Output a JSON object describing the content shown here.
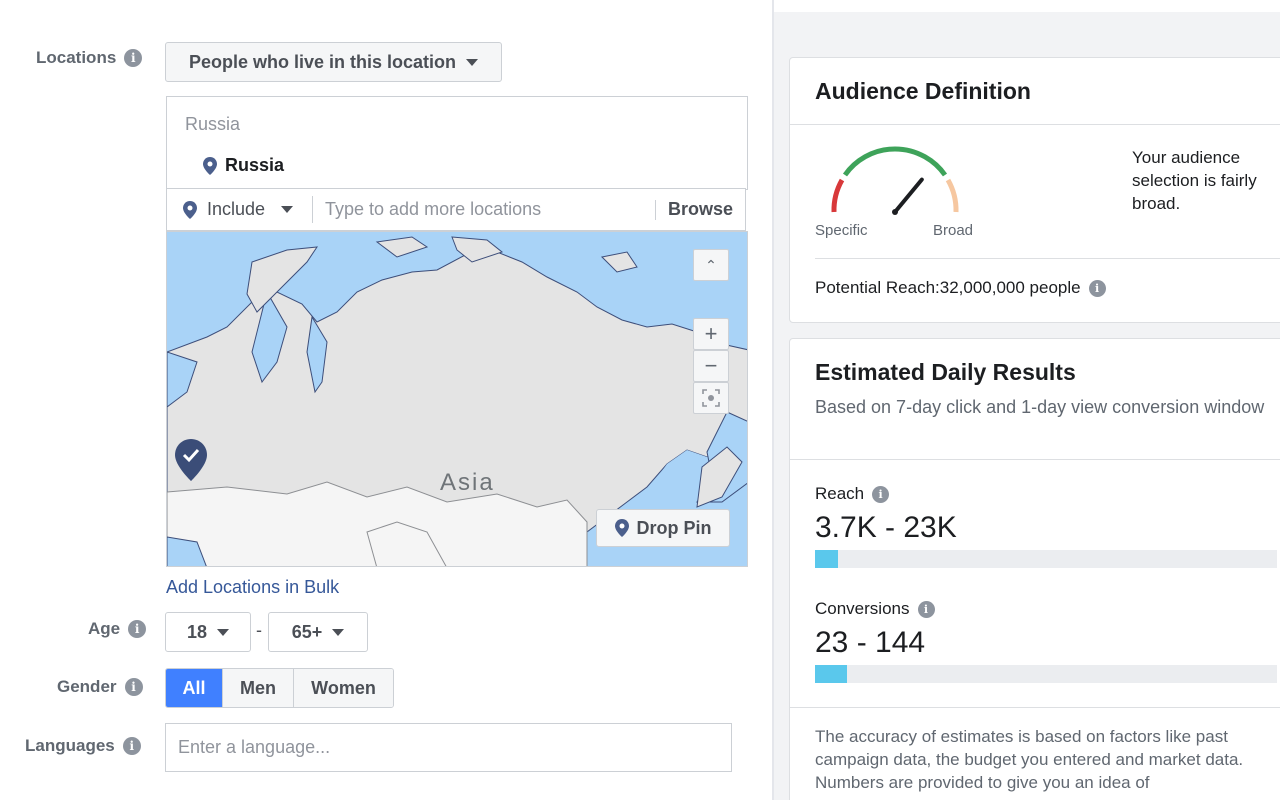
{
  "locations": {
    "label": "Locations",
    "type_dropdown": "People who live in this location",
    "country_group": "Russia",
    "selected": "Russia",
    "include_label": "Include",
    "input_placeholder": "Type to add more locations",
    "browse_label": "Browse",
    "map_label": "Asia",
    "drop_pin_label": "Drop Pin",
    "bulk_link": "Add Locations in Bulk"
  },
  "age": {
    "label": "Age",
    "min": "18",
    "separator": "-",
    "max": "65+"
  },
  "gender": {
    "label": "Gender",
    "options": [
      "All",
      "Men",
      "Women"
    ],
    "selected": "All"
  },
  "languages": {
    "label": "Languages",
    "placeholder": "Enter a language..."
  },
  "audience_definition": {
    "title": "Audience Definition",
    "gauge_left": "Specific",
    "gauge_right": "Broad",
    "description": "Your audience selection is fairly broad.",
    "potential_reach": "Potential Reach:32,000,000 people",
    "gauge_level": 0.72
  },
  "daily_results": {
    "title": "Estimated Daily Results",
    "subtitle": "Based on 7-day click and 1-day view conversion window",
    "reach_label": "Reach",
    "reach_value": "3.7K - 23K",
    "reach_fill": 0.05,
    "conversions_label": "Conversions",
    "conversions_value": "23 - 144",
    "conversions_fill": 0.07,
    "note": "The accuracy of estimates is based on factors like past campaign data, the budget you entered and market data. Numbers are provided to give you an idea of"
  },
  "colors": {
    "accent": "#4080ff",
    "tab_indicator": "#1877f2",
    "bar_fill": "#5ac8ec",
    "link": "#365899"
  }
}
